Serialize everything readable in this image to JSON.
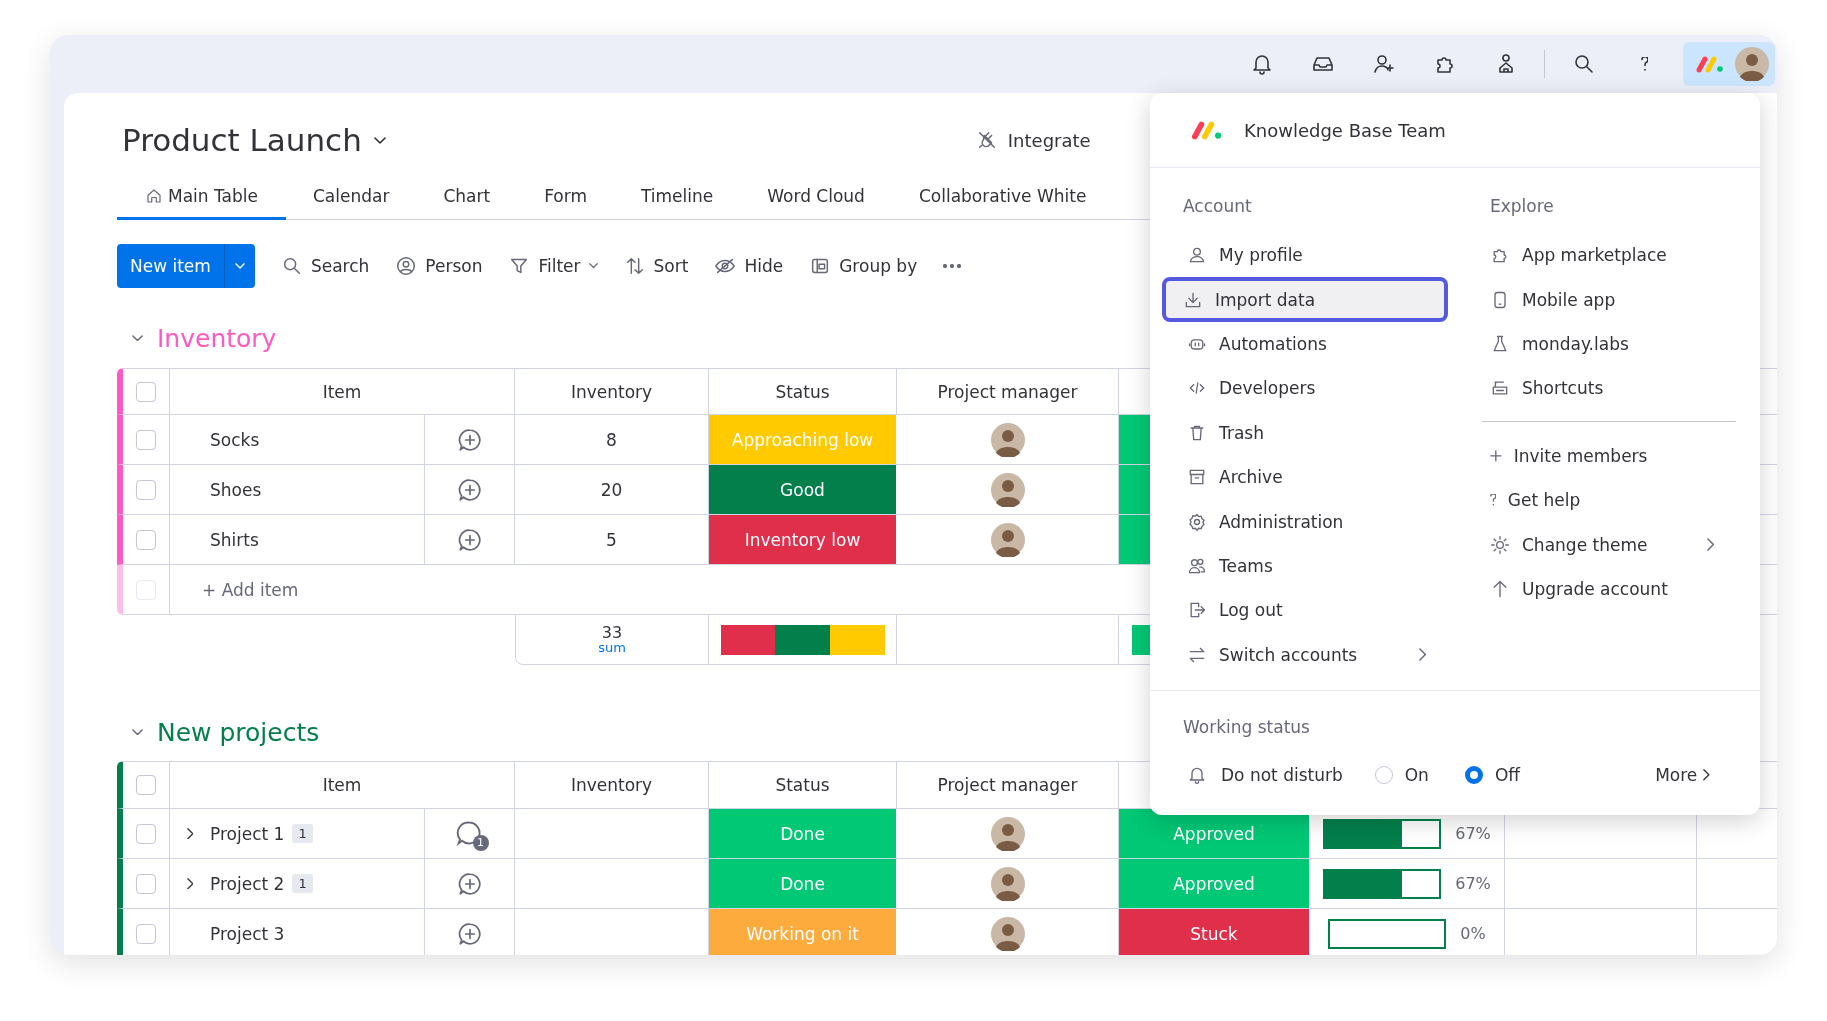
{
  "board": {
    "title": "Product Launch",
    "integrate": "Integrate"
  },
  "views": [
    {
      "label": "Main Table",
      "selected": true
    },
    {
      "label": "Calendar",
      "selected": false
    },
    {
      "label": "Chart",
      "selected": false
    },
    {
      "label": "Form",
      "selected": false
    },
    {
      "label": "Timeline",
      "selected": false
    },
    {
      "label": "Word Cloud",
      "selected": false
    },
    {
      "label": "Collaborative White",
      "selected": false
    }
  ],
  "toolbar": {
    "new_item": "New item",
    "actions": [
      "Search",
      "Person",
      "Filter",
      "Sort",
      "Hide",
      "Group by"
    ]
  },
  "groups": [
    {
      "title": "Inventory",
      "color": "#ff5ac4",
      "all_checked": false,
      "columns": [
        "Item",
        "Inventory",
        "Status",
        "Project manager"
      ],
      "rows": [
        {
          "checked": false,
          "name": "Socks",
          "inventory": "8",
          "status": {
            "label": "Approaching low",
            "color": "#ffcb00"
          },
          "column_6": {
            "color": "#00c875"
          }
        },
        {
          "checked": false,
          "name": "Shoes",
          "inventory": "20",
          "status": {
            "label": "Good",
            "color": "#037f4c"
          },
          "column_6": {
            "color": "#00c875"
          }
        },
        {
          "checked": false,
          "name": "Shirts",
          "inventory": "5",
          "status": {
            "label": "Inventory low",
            "color": "#df2f4a"
          },
          "column_6": {
            "color": "#00c875"
          }
        }
      ],
      "add_item": "+ Add item",
      "add_item_disabled": true,
      "summary": {
        "sum": "33",
        "sum_label": "sum",
        "status_segments": [
          {
            "color": "#df2f4a"
          },
          {
            "color": "#037f4c"
          },
          {
            "color": "#ffcb00"
          }
        ],
        "column_6": {
          "color": "#00c875"
        }
      }
    },
    {
      "title": "New projects",
      "color": "#037f4c",
      "all_checked": false,
      "columns": [
        "Item",
        "Inventory",
        "Status",
        "Project manager"
      ],
      "rows": [
        {
          "checked": false,
          "expandable": true,
          "name": "Project 1",
          "subitems": "1",
          "comments": "1",
          "status": {
            "label": "Done",
            "color": "#00c875"
          },
          "approval": {
            "label": "Approved",
            "color": "#00c875"
          },
          "progress": {
            "level": 0.67,
            "reading": "67%"
          }
        },
        {
          "checked": false,
          "expandable": true,
          "name": "Project 2",
          "subitems": "1",
          "status": {
            "label": "Done",
            "color": "#00c875"
          },
          "approval": {
            "label": "Approved",
            "color": "#00c875"
          },
          "progress": {
            "level": 0.67,
            "reading": "67%"
          }
        },
        {
          "checked": false,
          "expandable": false,
          "name": "Project 3",
          "status": {
            "label": "Working on it",
            "color": "#fdab3d"
          },
          "approval": {
            "label": "Stuck",
            "color": "#df2f4a"
          },
          "progress": {
            "level": 0,
            "reading": "0%"
          }
        }
      ]
    }
  ],
  "account_menu": {
    "team": "Knowledge Base Team",
    "account": {
      "title": "Account",
      "items": [
        {
          "label": "My profile",
          "selected": false,
          "submenu": false
        },
        {
          "label": "Import data",
          "selected": true,
          "submenu": false
        },
        {
          "label": "Automations",
          "selected": false,
          "submenu": false
        },
        {
          "label": "Developers",
          "selected": false,
          "submenu": false
        },
        {
          "label": "Trash",
          "selected": false,
          "submenu": false
        },
        {
          "label": "Archive",
          "selected": false,
          "submenu": false
        },
        {
          "label": "Administration",
          "selected": false,
          "submenu": false
        },
        {
          "label": "Teams",
          "selected": false,
          "submenu": false
        },
        {
          "label": "Log out",
          "selected": false,
          "submenu": false
        },
        {
          "label": "Switch accounts",
          "selected": false,
          "submenu": true
        }
      ]
    },
    "explore": {
      "title": "Explore",
      "items": [
        {
          "label": "App marketplace",
          "submenu": false
        },
        {
          "label": "Mobile app",
          "submenu": false
        },
        {
          "label": "monday.labs",
          "submenu": false
        },
        {
          "label": "Shortcuts",
          "submenu": false
        }
      ]
    },
    "more_items": [
      {
        "label": "Invite members",
        "submenu": false
      },
      {
        "label": "Get help",
        "submenu": false
      },
      {
        "label": "Change theme",
        "submenu": true
      },
      {
        "label": "Upgrade account",
        "submenu": false
      }
    ],
    "working_status": {
      "title": "Working status",
      "label": "Do not disturb",
      "options": [
        {
          "label": "On",
          "selected": false
        },
        {
          "label": "Off",
          "selected": true
        }
      ],
      "more": "More"
    }
  }
}
